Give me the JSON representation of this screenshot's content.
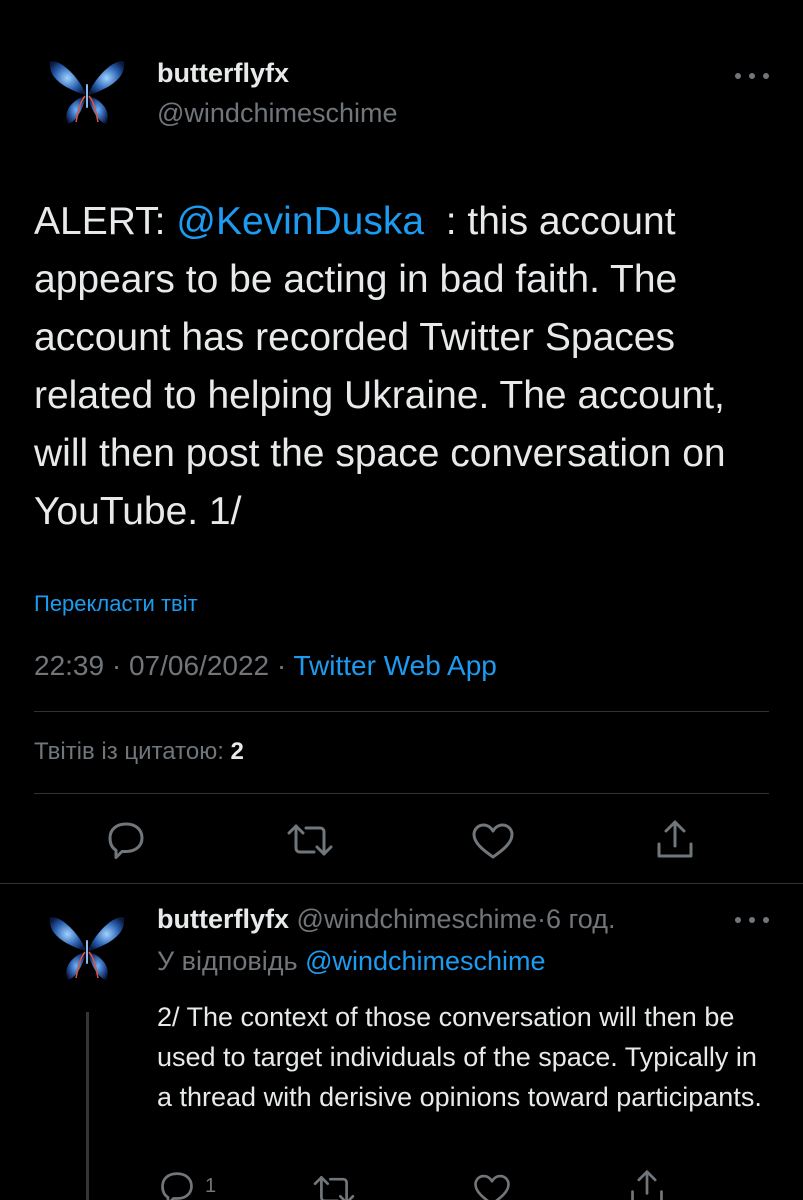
{
  "main_tweet": {
    "display_name": "butterflyfx",
    "handle": "@windchimeschime",
    "text_prefix": "ALERT: ",
    "mention": "@KevinDuska",
    "text_suffix": "  : this account appears to be acting in bad faith. The account has recorded Twitter Spaces related to helping Ukraine. The account, will then post the space conversation on YouTube. 1/",
    "translate_label": "Перекласти твіт",
    "time": "22:39",
    "date": "07/06/2022",
    "source": "Twitter Web App",
    "quote_label": "Твітів із цитатою:",
    "quote_count": "2",
    "actions": {
      "reply": "reply-icon",
      "retweet": "retweet-icon",
      "like": "heart-icon",
      "share": "share-icon"
    }
  },
  "reply_tweet": {
    "display_name": "butterflyfx",
    "handle": "@windchimeschime",
    "separator": "·",
    "time_ago": "6 год.",
    "reply_to_label": "У відповідь",
    "reply_to_mention": "@windchimeschime",
    "text": "2/ The context of those conversation will then be used to target individuals of the space. Typically in a thread with derisive opinions toward participants.",
    "reply_count": "1"
  },
  "colors": {
    "background": "#000000",
    "text": "#e7e9ea",
    "secondary": "#71767b",
    "accent": "#1d9bf0",
    "divider": "#2f3336"
  }
}
